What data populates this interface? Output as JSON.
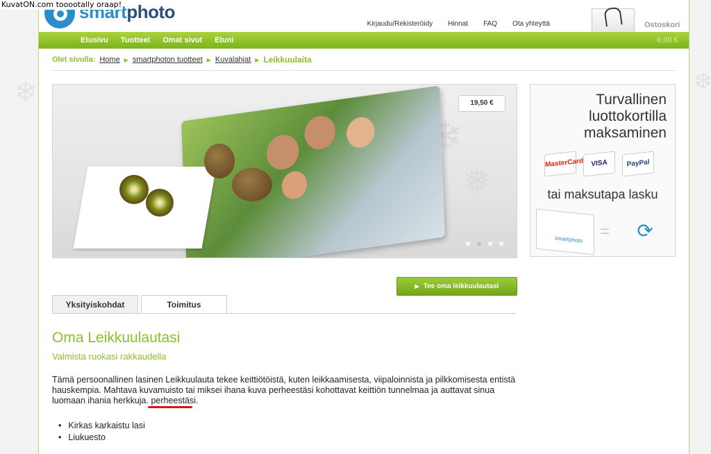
{
  "watermark": "KuvatON.com tooootally oraap!",
  "logo": {
    "part1": "smart",
    "part2": "photo"
  },
  "top_links": [
    "Kirjaudu/Rekisteröidy",
    "Hinnat",
    "FAQ",
    "Ota yhteyttä"
  ],
  "cart": {
    "label": "Ostoskori",
    "total": "0,00 €"
  },
  "nav": [
    "Etusivu",
    "Tuotteet",
    "Omat sivut",
    "Etuni"
  ],
  "breadcrumb": {
    "label": "Olet sivulla:",
    "links": [
      "Home",
      "smartphoton tuotteet",
      "Kuvalahjat"
    ],
    "current": "Leikkuulaita"
  },
  "hero": {
    "price": "19,50 €",
    "slides": 4,
    "active_slide": 2
  },
  "promo": {
    "title_lines": [
      "Turvallinen",
      "luottokortilla",
      "maksaminen"
    ],
    "cards": [
      "MasterCard",
      "VISA",
      "PayPal"
    ],
    "subtitle": "tai maksutapa lasku",
    "parcel_brand": "smartphoto"
  },
  "cta": {
    "label": "Tee oma leikkuulautasi"
  },
  "tabs": [
    "Yksityiskohdat",
    "Toimitus"
  ],
  "product": {
    "title": "Oma Leikkuulautasi",
    "subtitle": "Valmista ruokasi rakkaudella",
    "description": "Tämä persoonallinen lasinen Leikkuulauta tekee keittiötöistä, kuten leikkaamisesta, viipaloinnista ja pilkkomisesta entistä hauskempia. Mahtava kuvamuisto tai miksei ihana kuva perheestäsi kohottavat keittiön tunnelmaa ja auttavat sinua luomaan ihania herkkuja. perheestäsi.",
    "features": [
      "Kirkas karkaistu lasi",
      "Liukuesto"
    ]
  },
  "colors": {
    "brand_green": "#8bbf2a",
    "brand_blue": "#2a8fc8",
    "annotation_red": "#d21818"
  }
}
